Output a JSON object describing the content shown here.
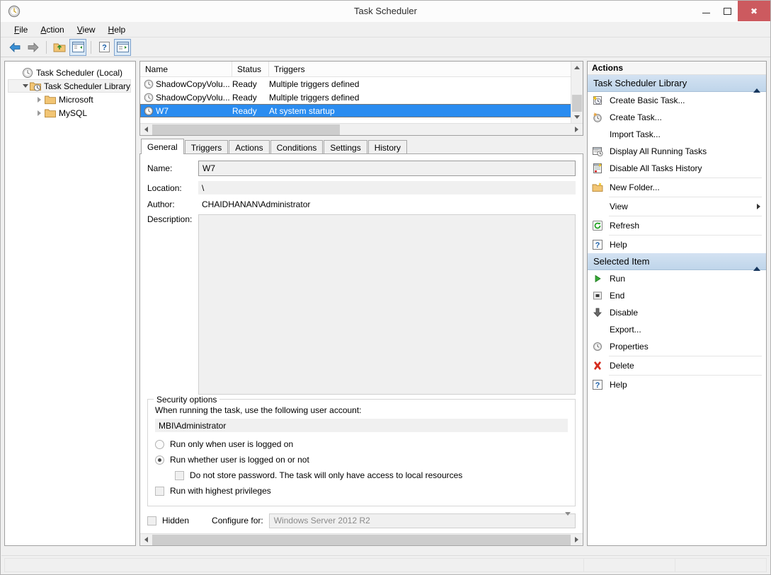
{
  "window": {
    "title": "Task Scheduler",
    "icon": "clock-icon",
    "minimize_label": "Minimize",
    "maximize_label": "Maximize",
    "close_label": "Close"
  },
  "menubar": {
    "items": [
      {
        "label": "File",
        "accel": "F"
      },
      {
        "label": "Action",
        "accel": "A"
      },
      {
        "label": "View",
        "accel": "V"
      },
      {
        "label": "Help",
        "accel": "H"
      }
    ]
  },
  "toolbar": {
    "items": [
      {
        "name": "back-icon",
        "label": "Back",
        "active": false
      },
      {
        "name": "forward-icon",
        "label": "Forward",
        "active": false
      },
      {
        "name": "up-folder-icon",
        "label": "Up One Level",
        "active": false
      },
      {
        "name": "show-hide-console-tree-icon",
        "label": "Show/Hide Console Tree",
        "active": true
      },
      {
        "name": "help-icon",
        "label": "Help",
        "active": false
      },
      {
        "name": "show-hide-action-pane-icon",
        "label": "Show/Hide Action Pane",
        "active": true
      }
    ]
  },
  "tree": {
    "items": [
      {
        "label": "Task Scheduler (Local)",
        "level": 0,
        "icon": "clock-icon",
        "expander": "none",
        "selected": false
      },
      {
        "label": "Task Scheduler Library",
        "level": 1,
        "icon": "library-icon",
        "expander": "down",
        "selected": true
      },
      {
        "label": "Microsoft",
        "level": 2,
        "icon": "folder-icon",
        "expander": "right",
        "selected": false
      },
      {
        "label": "MySQL",
        "level": 2,
        "icon": "folder-icon",
        "expander": "right",
        "selected": false
      }
    ]
  },
  "task_list": {
    "columns": [
      "Name",
      "Status",
      "Triggers"
    ],
    "rows": [
      {
        "name": "ShadowCopyVolu...",
        "status": "Ready",
        "triggers": "Multiple triggers defined",
        "selected": false
      },
      {
        "name": "ShadowCopyVolu...",
        "status": "Ready",
        "triggers": "Multiple triggers defined",
        "selected": false
      },
      {
        "name": "W7",
        "status": "Ready",
        "triggers": "At system startup",
        "selected": true
      }
    ]
  },
  "tabs": [
    {
      "label": "General",
      "active": true
    },
    {
      "label": "Triggers",
      "active": false
    },
    {
      "label": "Actions",
      "active": false
    },
    {
      "label": "Conditions",
      "active": false
    },
    {
      "label": "Settings",
      "active": false
    },
    {
      "label": "History",
      "active": false
    }
  ],
  "general": {
    "name_label": "Name:",
    "name_value": "W7",
    "location_label": "Location:",
    "location_value": "\\",
    "author_label": "Author:",
    "author_value": "CHAIDHANAN\\Administrator",
    "description_label": "Description:",
    "description_value": ""
  },
  "security": {
    "group_title": "Security options",
    "account_prompt": "When running the task, use the following user account:",
    "account_value": "MBI\\Administrator",
    "options": [
      {
        "type": "radio",
        "label": "Run only when user is logged on",
        "checked": false,
        "indent": false
      },
      {
        "type": "radio",
        "label": "Run whether user is logged on or not",
        "checked": true,
        "indent": false
      },
      {
        "type": "checkbox",
        "label": "Do not store password.  The task will only have access to local resources",
        "checked": false,
        "indent": true
      },
      {
        "type": "checkbox",
        "label": "Run with highest privileges",
        "checked": false,
        "indent": false
      }
    ]
  },
  "bottom": {
    "hidden_label": "Hidden",
    "hidden_checked": false,
    "configure_label": "Configure for:",
    "configure_value": "Windows Server 2012 R2"
  },
  "actions_pane": {
    "title": "Actions",
    "sections": [
      {
        "header": "Task Scheduler Library",
        "items": [
          {
            "label": "Create Basic Task...",
            "icon": "create-basic-task-icon",
            "divider_after": false
          },
          {
            "label": "Create Task...",
            "icon": "create-task-icon",
            "divider_after": false
          },
          {
            "label": "Import Task...",
            "icon": "none",
            "divider_after": false
          },
          {
            "label": "Display All Running Tasks",
            "icon": "running-tasks-icon",
            "divider_after": false
          },
          {
            "label": "Disable All Tasks History",
            "icon": "history-icon",
            "divider_after": true
          },
          {
            "label": "New Folder...",
            "icon": "new-folder-icon",
            "divider_after": true
          },
          {
            "label": "View",
            "icon": "none",
            "submenu": true,
            "divider_after": true
          },
          {
            "label": "Refresh",
            "icon": "refresh-icon",
            "divider_after": true
          },
          {
            "label": "Help",
            "icon": "help-icon",
            "divider_after": false
          }
        ]
      },
      {
        "header": "Selected Item",
        "items": [
          {
            "label": "Run",
            "icon": "run-icon",
            "divider_after": false
          },
          {
            "label": "End",
            "icon": "end-icon",
            "divider_after": false
          },
          {
            "label": "Disable",
            "icon": "disable-icon",
            "divider_after": false
          },
          {
            "label": "Export...",
            "icon": "none",
            "divider_after": false
          },
          {
            "label": "Properties",
            "icon": "properties-icon",
            "divider_after": true
          },
          {
            "label": "Delete",
            "icon": "delete-icon",
            "divider_after": true
          },
          {
            "label": "Help",
            "icon": "help-icon",
            "divider_after": false
          }
        ]
      }
    ]
  },
  "statusbar": {
    "panes": [
      "",
      "",
      ""
    ]
  },
  "colors": {
    "selection_blue": "#2a8cf0",
    "close_red": "#cc5a5f",
    "section_header_blue": "#c7daee",
    "window_bg": "#f0f0f0"
  }
}
